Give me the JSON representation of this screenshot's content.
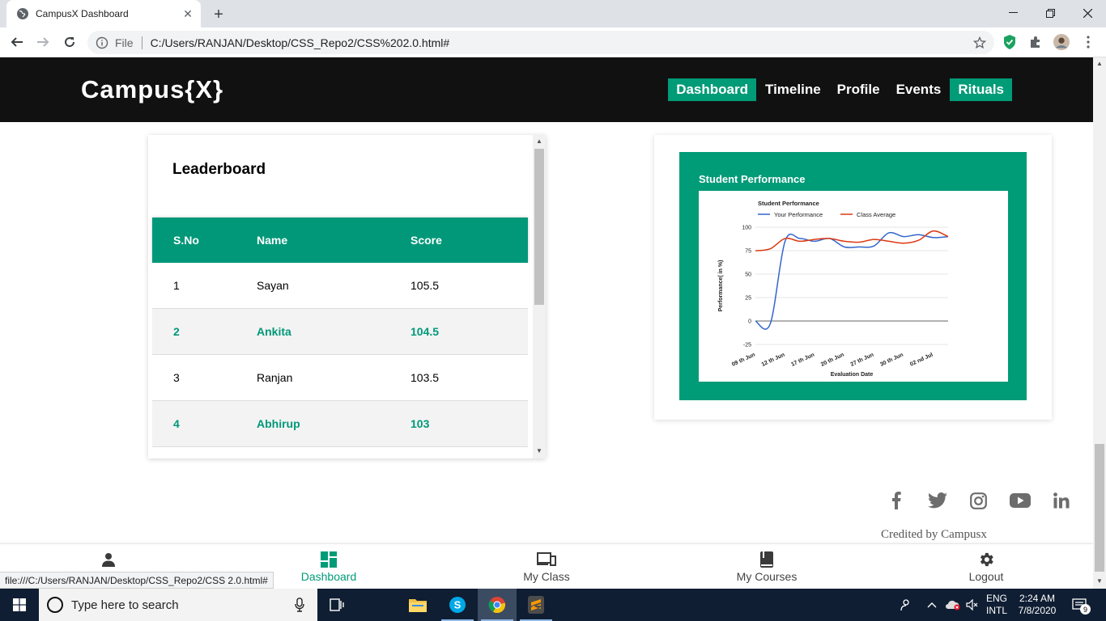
{
  "browser": {
    "tab_title": "CampusX Dashboard",
    "file_label": "File",
    "url": "C:/Users/RANJAN/Desktop/CSS_Repo2/CSS%202.0.html#",
    "status_url": "file:///C:/Users/RANJAN/Desktop/CSS_Repo2/CSS 2.0.html#"
  },
  "header": {
    "logo": "Campus{X}",
    "nav": [
      {
        "label": "Dashboard",
        "active": true
      },
      {
        "label": "Timeline",
        "active": false
      },
      {
        "label": "Profile",
        "active": false
      },
      {
        "label": "Events",
        "active": false
      },
      {
        "label": "Rituals",
        "active": true
      }
    ]
  },
  "leaderboard": {
    "title": "Leaderboard",
    "columns": [
      "S.No",
      "Name",
      "Score"
    ],
    "rows": [
      {
        "sno": "1",
        "name": "Sayan",
        "score": "105.5"
      },
      {
        "sno": "2",
        "name": "Ankita",
        "score": "104.5"
      },
      {
        "sno": "3",
        "name": "Ranjan",
        "score": "103.5"
      },
      {
        "sno": "4",
        "name": "Abhirup",
        "score": "103"
      }
    ]
  },
  "chart_card": {
    "heading": "Student Performance"
  },
  "chart_data": {
    "type": "line",
    "title": "Student Performance",
    "xlabel": "Evaluation Date",
    "ylabel": "Performance( in %)",
    "ylim": [
      -25,
      100
    ],
    "yticks": [
      100,
      75,
      50,
      25,
      0,
      -25
    ],
    "xtick_labels": [
      "09 th Jun",
      "12 th Jun",
      "17 th Jun",
      "20 th Jun",
      "27 th Jun",
      "30 th Jun",
      "02 nd Jul"
    ],
    "x": [
      0,
      0.5,
      1,
      1.5,
      2,
      2.5,
      3,
      3.5,
      4,
      4.5,
      5,
      5.5,
      6,
      6.5
    ],
    "series": [
      {
        "name": "Your Performance",
        "color": "#3366cc",
        "values": [
          0,
          -3,
          85,
          88,
          85,
          88,
          79,
          79,
          80,
          94,
          90,
          92,
          89,
          90
        ]
      },
      {
        "name": "Class Average",
        "color": "#dc3912",
        "values": [
          75,
          77,
          88,
          85,
          87,
          88,
          85,
          84,
          87,
          85,
          83,
          86,
          96,
          90
        ]
      }
    ],
    "grid": true,
    "legend": "top-left"
  },
  "social": {
    "icons": [
      "facebook-icon",
      "twitter-icon",
      "instagram-icon",
      "youtube-icon",
      "linkedin-icon"
    ],
    "credit": "Credited by Campusx"
  },
  "bottom_nav": [
    {
      "label": "",
      "icon": "person-icon"
    },
    {
      "label": "Dashboard",
      "icon": "dashboard-icon",
      "active": true
    },
    {
      "label": "My Class",
      "icon": "devices-icon"
    },
    {
      "label": "My Courses",
      "icon": "book-icon"
    },
    {
      "label": "Logout",
      "icon": "gear-icon"
    }
  ],
  "taskbar": {
    "search_placeholder": "Type here to search",
    "lang_top": "ENG",
    "lang_bottom": "INTL",
    "time": "2:24 AM",
    "date": "7/8/2020",
    "notifications": "9"
  },
  "colors": {
    "brand": "#009b77",
    "header_bg": "#111111"
  }
}
